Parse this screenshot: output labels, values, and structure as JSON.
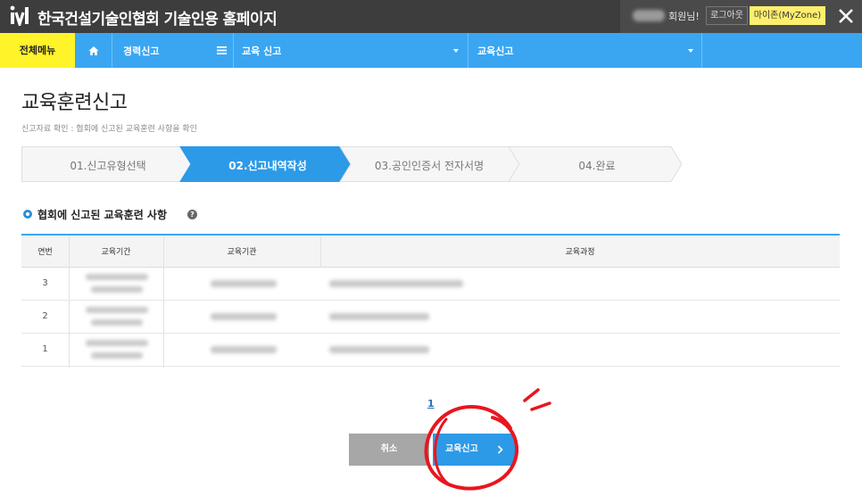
{
  "header": {
    "app_title": "한국건설기술인협회 기술인용 홈페이지",
    "greeting": "회원님!",
    "logout_label": "로그아웃",
    "myzone_label": "마이존(MyZone)"
  },
  "nav": {
    "all_menu": "전체메뉴",
    "item1": "경력신고",
    "item2": "교육 신고",
    "item3": "교육신고"
  },
  "page": {
    "title": "교육훈련신고",
    "description": "신고자료 확인 : 협회에 신고된 교육훈련 사항을 확인"
  },
  "steps": [
    {
      "label": "01.신고유형선택",
      "active": false
    },
    {
      "label": "02.신고내역작성",
      "active": true
    },
    {
      "label": "03.공인인증서 전자서명",
      "active": false
    },
    {
      "label": "04.완료",
      "active": false
    }
  ],
  "section": {
    "title": "협회에 신고된 교육훈련 사항"
  },
  "table": {
    "headers": [
      "연번",
      "교육기간",
      "교육기관",
      "교육과정"
    ],
    "rows": [
      {
        "num": "3"
      },
      {
        "num": "2"
      },
      {
        "num": "1"
      }
    ]
  },
  "pagination": {
    "current": "1"
  },
  "buttons": {
    "cancel": "취소",
    "submit": "교육신고"
  },
  "colors": {
    "nav_blue": "#3aa6f2",
    "menu_yellow": "#fff32a",
    "active_step": "#2d9ae8",
    "annotation_red": "#e8161f"
  }
}
